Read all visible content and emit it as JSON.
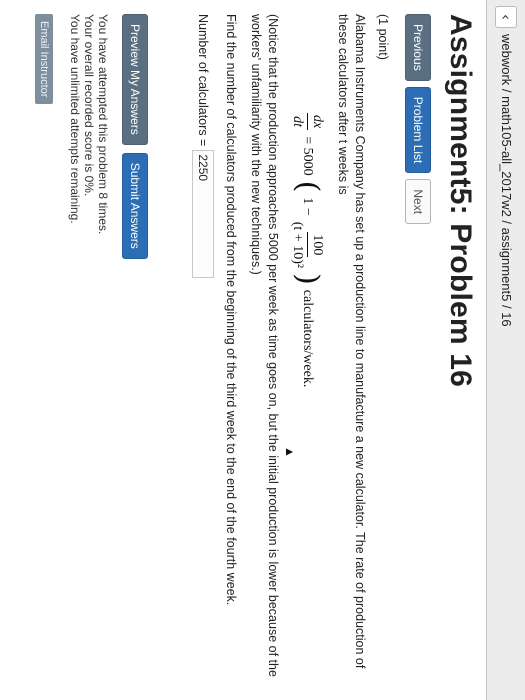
{
  "browser": {
    "back_glyph": "‹",
    "breadcrumb": "webwork / math105-all_2017w2 / assignment5 / 16"
  },
  "page": {
    "title": "Assignment5: Problem 16"
  },
  "nav": {
    "previous": "Previous",
    "problem_list": "Problem List",
    "next": "Next"
  },
  "problem": {
    "points": "(1 point)",
    "statement": "Alabama Instruments Company has set up a production line to manufacture a new calculator. The rate of production of these calculators after t weeks is",
    "equation": {
      "lhs_num": "dx",
      "lhs_den": "dt",
      "equals": "= 5000",
      "paren_open": "(",
      "one_minus": "1 −",
      "inner_num": "100",
      "inner_den": "(t + 10)²",
      "paren_close": ")",
      "units": "calculators/week."
    },
    "note": "(Notice that the production approaches 5000 per week as time goes on, but the initial production is lower because of the workers' unfamiliarity with the new techniques.)",
    "question": "Find the number of calculators produced from the beginning of the third week to the end of the fourth week.",
    "answer_label": "Number of calculators =",
    "answer_value": "2250"
  },
  "actions": {
    "preview": "Preview My Answers",
    "submit": "Submit Answers"
  },
  "status": {
    "attempts": "You have attempted this problem 8 times.",
    "score": "Your overall recorded score is 0%.",
    "remaining": "You have unlimited attempts remaining."
  },
  "footer": {
    "email": "Email Instructor"
  }
}
